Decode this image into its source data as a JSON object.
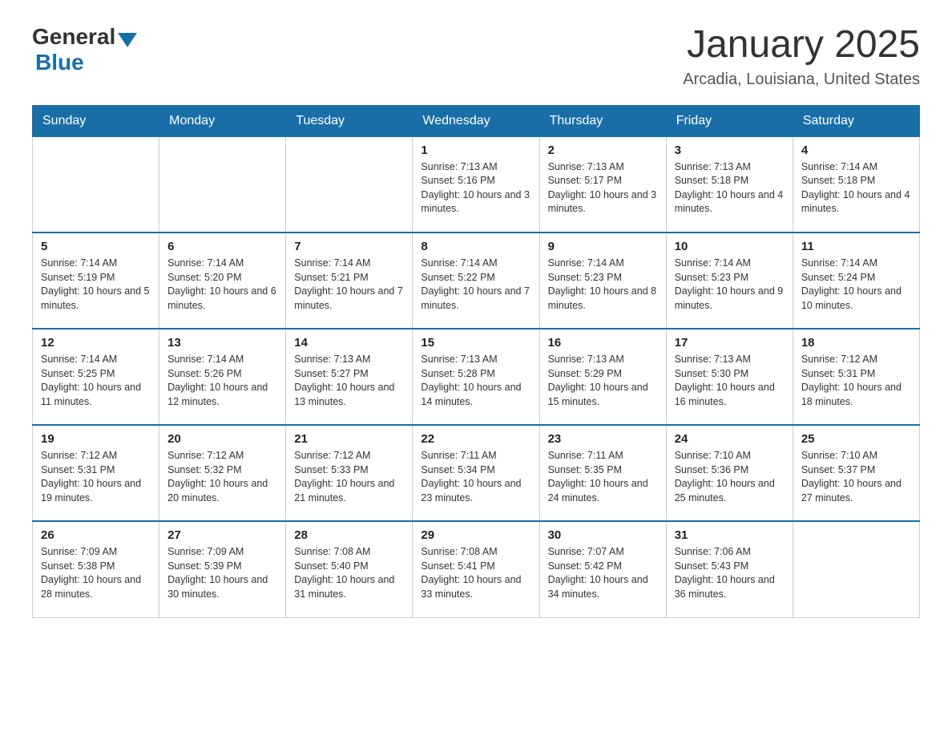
{
  "header": {
    "logo_general": "General",
    "logo_blue": "Blue",
    "month_title": "January 2025",
    "location": "Arcadia, Louisiana, United States"
  },
  "days_of_week": [
    "Sunday",
    "Monday",
    "Tuesday",
    "Wednesday",
    "Thursday",
    "Friday",
    "Saturday"
  ],
  "weeks": [
    [
      {
        "day": "",
        "info": ""
      },
      {
        "day": "",
        "info": ""
      },
      {
        "day": "",
        "info": ""
      },
      {
        "day": "1",
        "info": "Sunrise: 7:13 AM\nSunset: 5:16 PM\nDaylight: 10 hours and 3 minutes."
      },
      {
        "day": "2",
        "info": "Sunrise: 7:13 AM\nSunset: 5:17 PM\nDaylight: 10 hours and 3 minutes."
      },
      {
        "day": "3",
        "info": "Sunrise: 7:13 AM\nSunset: 5:18 PM\nDaylight: 10 hours and 4 minutes."
      },
      {
        "day": "4",
        "info": "Sunrise: 7:14 AM\nSunset: 5:18 PM\nDaylight: 10 hours and 4 minutes."
      }
    ],
    [
      {
        "day": "5",
        "info": "Sunrise: 7:14 AM\nSunset: 5:19 PM\nDaylight: 10 hours and 5 minutes."
      },
      {
        "day": "6",
        "info": "Sunrise: 7:14 AM\nSunset: 5:20 PM\nDaylight: 10 hours and 6 minutes."
      },
      {
        "day": "7",
        "info": "Sunrise: 7:14 AM\nSunset: 5:21 PM\nDaylight: 10 hours and 7 minutes."
      },
      {
        "day": "8",
        "info": "Sunrise: 7:14 AM\nSunset: 5:22 PM\nDaylight: 10 hours and 7 minutes."
      },
      {
        "day": "9",
        "info": "Sunrise: 7:14 AM\nSunset: 5:23 PM\nDaylight: 10 hours and 8 minutes."
      },
      {
        "day": "10",
        "info": "Sunrise: 7:14 AM\nSunset: 5:23 PM\nDaylight: 10 hours and 9 minutes."
      },
      {
        "day": "11",
        "info": "Sunrise: 7:14 AM\nSunset: 5:24 PM\nDaylight: 10 hours and 10 minutes."
      }
    ],
    [
      {
        "day": "12",
        "info": "Sunrise: 7:14 AM\nSunset: 5:25 PM\nDaylight: 10 hours and 11 minutes."
      },
      {
        "day": "13",
        "info": "Sunrise: 7:14 AM\nSunset: 5:26 PM\nDaylight: 10 hours and 12 minutes."
      },
      {
        "day": "14",
        "info": "Sunrise: 7:13 AM\nSunset: 5:27 PM\nDaylight: 10 hours and 13 minutes."
      },
      {
        "day": "15",
        "info": "Sunrise: 7:13 AM\nSunset: 5:28 PM\nDaylight: 10 hours and 14 minutes."
      },
      {
        "day": "16",
        "info": "Sunrise: 7:13 AM\nSunset: 5:29 PM\nDaylight: 10 hours and 15 minutes."
      },
      {
        "day": "17",
        "info": "Sunrise: 7:13 AM\nSunset: 5:30 PM\nDaylight: 10 hours and 16 minutes."
      },
      {
        "day": "18",
        "info": "Sunrise: 7:12 AM\nSunset: 5:31 PM\nDaylight: 10 hours and 18 minutes."
      }
    ],
    [
      {
        "day": "19",
        "info": "Sunrise: 7:12 AM\nSunset: 5:31 PM\nDaylight: 10 hours and 19 minutes."
      },
      {
        "day": "20",
        "info": "Sunrise: 7:12 AM\nSunset: 5:32 PM\nDaylight: 10 hours and 20 minutes."
      },
      {
        "day": "21",
        "info": "Sunrise: 7:12 AM\nSunset: 5:33 PM\nDaylight: 10 hours and 21 minutes."
      },
      {
        "day": "22",
        "info": "Sunrise: 7:11 AM\nSunset: 5:34 PM\nDaylight: 10 hours and 23 minutes."
      },
      {
        "day": "23",
        "info": "Sunrise: 7:11 AM\nSunset: 5:35 PM\nDaylight: 10 hours and 24 minutes."
      },
      {
        "day": "24",
        "info": "Sunrise: 7:10 AM\nSunset: 5:36 PM\nDaylight: 10 hours and 25 minutes."
      },
      {
        "day": "25",
        "info": "Sunrise: 7:10 AM\nSunset: 5:37 PM\nDaylight: 10 hours and 27 minutes."
      }
    ],
    [
      {
        "day": "26",
        "info": "Sunrise: 7:09 AM\nSunset: 5:38 PM\nDaylight: 10 hours and 28 minutes."
      },
      {
        "day": "27",
        "info": "Sunrise: 7:09 AM\nSunset: 5:39 PM\nDaylight: 10 hours and 30 minutes."
      },
      {
        "day": "28",
        "info": "Sunrise: 7:08 AM\nSunset: 5:40 PM\nDaylight: 10 hours and 31 minutes."
      },
      {
        "day": "29",
        "info": "Sunrise: 7:08 AM\nSunset: 5:41 PM\nDaylight: 10 hours and 33 minutes."
      },
      {
        "day": "30",
        "info": "Sunrise: 7:07 AM\nSunset: 5:42 PM\nDaylight: 10 hours and 34 minutes."
      },
      {
        "day": "31",
        "info": "Sunrise: 7:06 AM\nSunset: 5:43 PM\nDaylight: 10 hours and 36 minutes."
      },
      {
        "day": "",
        "info": ""
      }
    ]
  ]
}
